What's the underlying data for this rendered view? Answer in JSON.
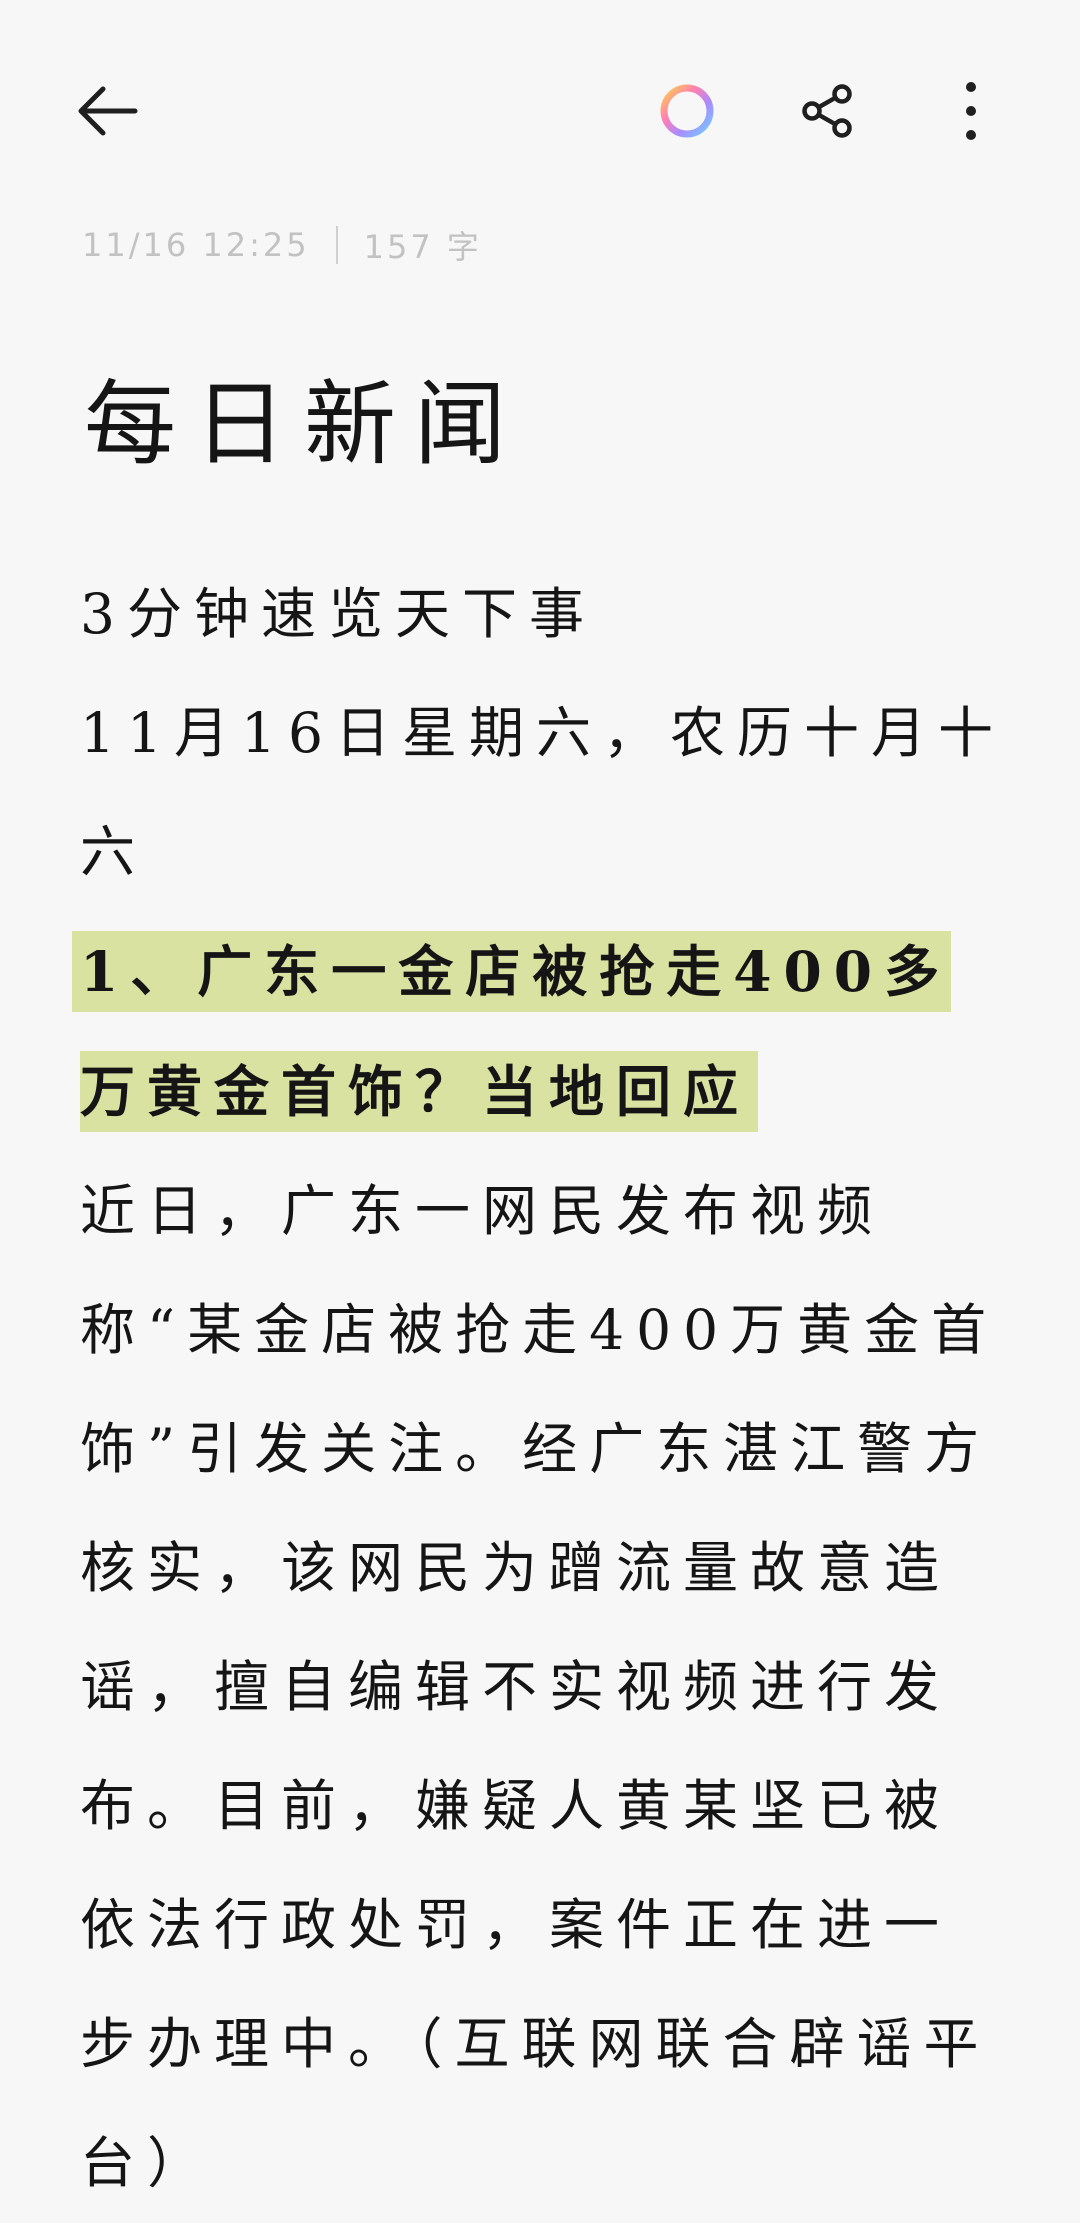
{
  "toolbar": {
    "back_icon": "arrow-left-icon",
    "color_icon": "color-ring-icon",
    "share_icon": "share-icon",
    "more_icon": "more-vertical-icon"
  },
  "meta": {
    "datetime": "11/16 12:25",
    "word_count": "157 字"
  },
  "note": {
    "title": "每日新闻",
    "subtitle": "3分钟速览天下事",
    "date_line": "11月16日星期六，农历十月十六",
    "headline": "1、广东一金店被抢走400多万黄金首饰？当地回应",
    "body": "近日，广东一网民发布视频称“某金店被抢走400万黄金首饰”引发关注。经广东湛江警方核实，该网民为蹭流量故意造谣，擅自编辑不实视频进行发布。目前，嫌疑人黄某坚已被依法行政处罚，案件正在进一步办理中。（互联网联合辟谣平台）"
  },
  "colors": {
    "background": "#f7f7f7",
    "highlight": "#d9e2a0",
    "meta_text": "#c2c2c2"
  }
}
